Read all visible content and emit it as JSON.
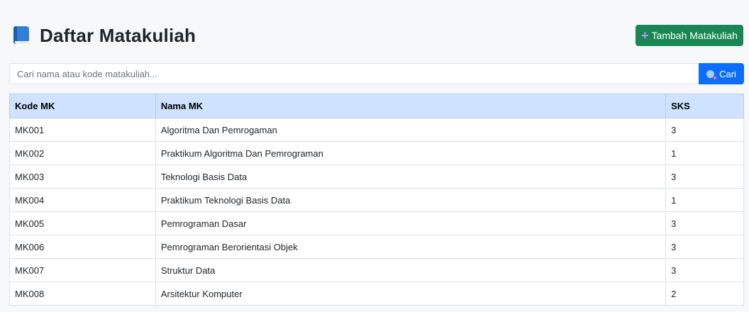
{
  "header": {
    "title": "Daftar Matakuliah",
    "title_icon": "book-icon",
    "add_button_label": "Tambah Matakuliah",
    "add_button_icon": "plus-icon",
    "add_button_color": "#198754"
  },
  "search": {
    "placeholder": "Cari nama atau kode matakuliah...",
    "value": "",
    "button_label": "Cari",
    "button_icon": "search-icon",
    "button_color": "#0d6efd"
  },
  "table": {
    "header_color": "#cfe2ff",
    "columns": [
      "Kode MK",
      "Nama MK",
      "SKS"
    ],
    "rows": [
      [
        "MK001",
        "Algoritma Dan Pemrogaman",
        "3"
      ],
      [
        "MK002",
        "Praktikum Algoritma Dan Pemrograman",
        "1"
      ],
      [
        "MK003",
        "Teknologi Basis Data",
        "3"
      ],
      [
        "MK004",
        "Praktikum Teknologi Basis Data",
        "1"
      ],
      [
        "MK005",
        "Pemrograman Dasar",
        "3"
      ],
      [
        "MK006",
        "Pemrograman Berorientasi Objek",
        "3"
      ],
      [
        "MK007",
        "Struktur Data",
        "3"
      ],
      [
        "MK008",
        "Arsitektur Komputer",
        "2"
      ]
    ]
  }
}
